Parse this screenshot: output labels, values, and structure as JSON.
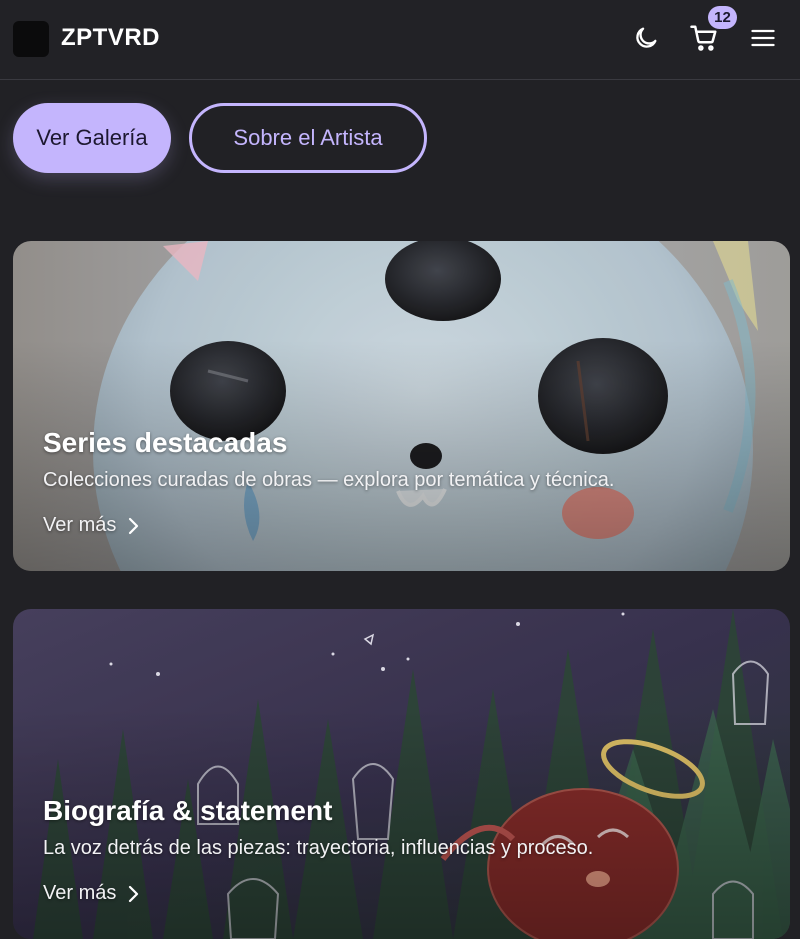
{
  "header": {
    "brand": "ZPTVRD",
    "cart_count": "12",
    "icons": [
      "logo-mark",
      "moon-icon",
      "cart-icon",
      "menu-icon"
    ]
  },
  "actions": {
    "primary_label": "Ver Galería",
    "secondary_label": "Sobre el Artista"
  },
  "cards": [
    {
      "title": "Series destacadas",
      "description": "Colecciones curadas de obras — explora por temática y técnica.",
      "link_label": "Ver más"
    },
    {
      "title": "Biografía & statement",
      "description": "La voz detrás de las piezas: trayectoria, influencias y proceso.",
      "link_label": "Ver más"
    }
  ],
  "colors": {
    "background": "#212125",
    "accent": "#c4b5fd",
    "text": "#ffffff"
  }
}
